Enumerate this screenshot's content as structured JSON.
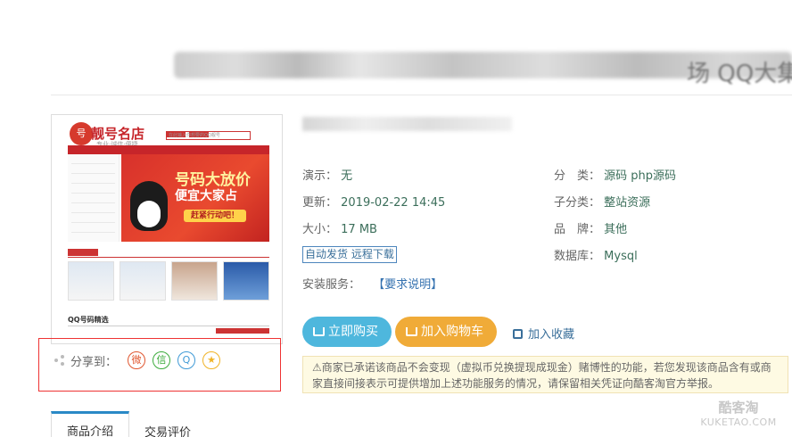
{
  "header": {
    "title_tail": "场 QQ大集"
  },
  "thumbnail": {
    "logo_mark": "号",
    "brand": "靓号名店",
    "slogan": "专业·诚信·便捷",
    "search_placeholder": "在此输入你想要的QQ靓号",
    "banner_line1": "号码大放价",
    "banner_line2": "便宜大家占",
    "banner_cta": "赶紧行动吧！",
    "section_title": "QQ号码精选"
  },
  "share": {
    "label": "分享到：",
    "targets": [
      "weibo-icon",
      "wechat-icon",
      "qq-icon",
      "qzone-icon"
    ]
  },
  "details": {
    "demo_label": "演示：",
    "demo_value": "无",
    "updated_label": "更新：",
    "updated_value": "2019-02-22 14:45",
    "size_label": "大小：",
    "size_value": "17 MB",
    "category_label": "分　类：",
    "category_value": "源码 php源码",
    "subcategory_label": "子分类：",
    "subcategory_value": "整站资源",
    "brand_label": "品　牌：",
    "brand_value": "其他",
    "database_label": "数据库：",
    "database_value": "Mysql",
    "delivery_badge": "自动发货 远程下载",
    "install_label": "安装服务：",
    "install_link": "【要求说明】"
  },
  "actions": {
    "buy_label": "立即购买",
    "cart_label": "加入购物车",
    "favorite_label": "加入收藏"
  },
  "notice": {
    "text": "⚠商家已承诺该商品不会变现（虚拟币兑换提现成现金）赌博性的功能，若您发现该商品含有或商家直接间接表示可提供增加上述功能服务的情况，请保留相关凭证向酷客淘官方举报。"
  },
  "tabs": {
    "intro": "商品介绍",
    "reviews": "交易评价"
  },
  "watermark": {
    "name": "酷客淘",
    "domain": "KUKETAO.COM"
  },
  "colors": {
    "buy_button": "#4eb7dd",
    "cart_button": "#f0ab38",
    "value_text": "#3b6e5a",
    "link_blue": "#3572b0",
    "highlight_box": "#e33333"
  }
}
